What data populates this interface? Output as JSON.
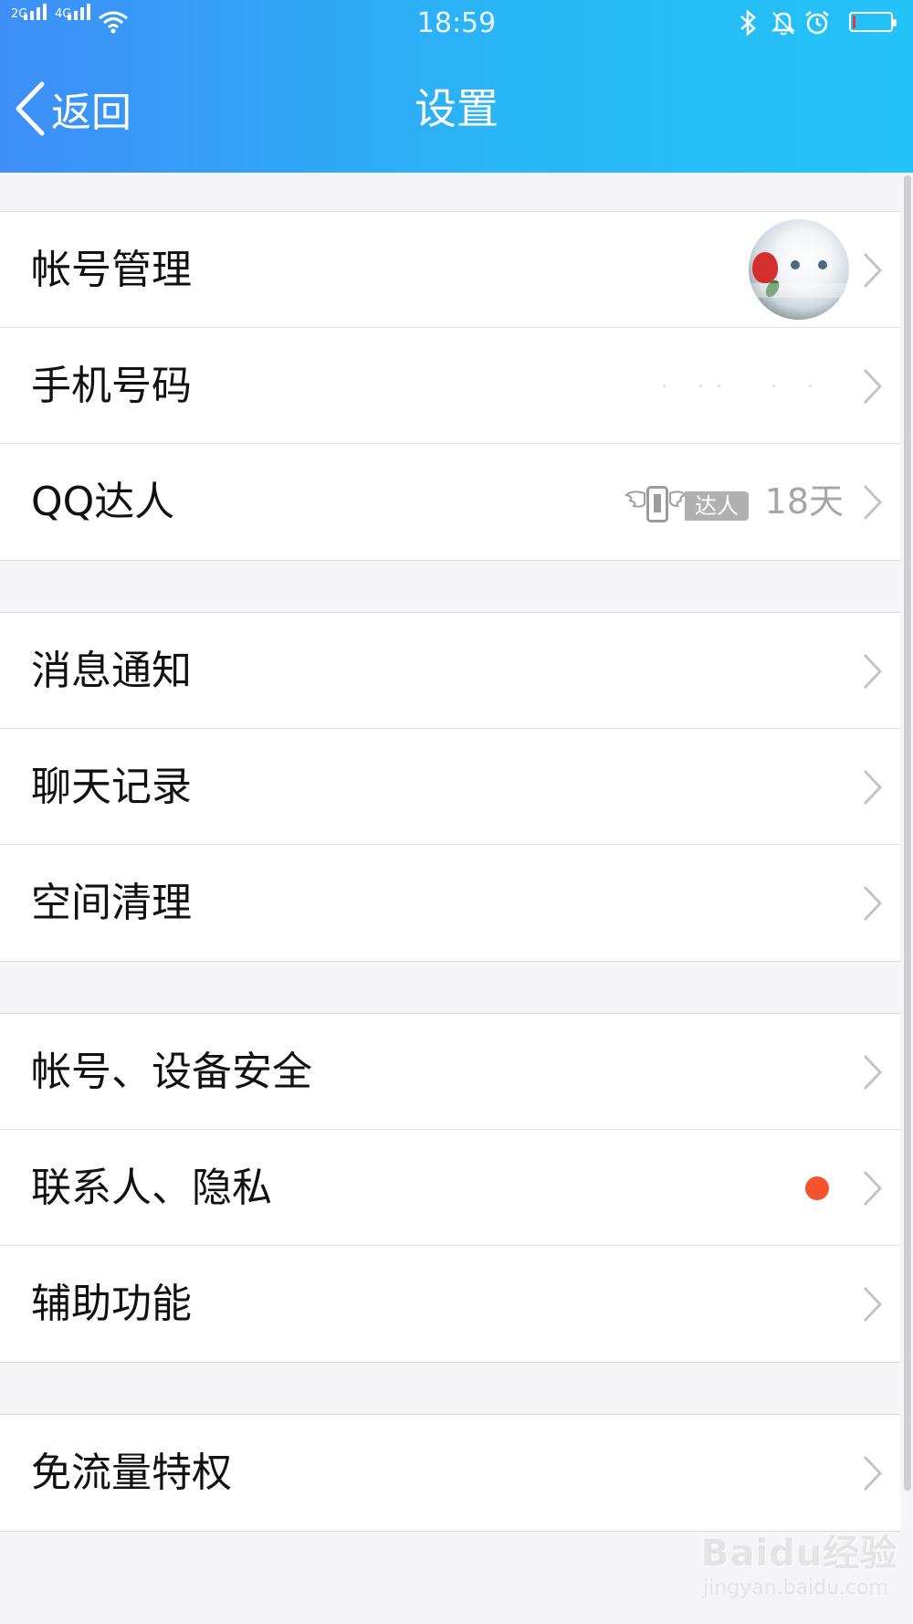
{
  "status_bar": {
    "sim1": "2G",
    "sim2": "4G",
    "time": "18:59",
    "battery_level": 0.08
  },
  "nav": {
    "back_label": "返回",
    "title": "设置"
  },
  "groups": [
    {
      "rows": [
        {
          "label": "帐号管理"
        },
        {
          "label": "手机号码"
        },
        {
          "label": "QQ达人",
          "badge_text": "达人",
          "days": "18天"
        }
      ]
    },
    {
      "rows": [
        {
          "label": "消息通知"
        },
        {
          "label": "聊天记录"
        },
        {
          "label": "空间清理"
        }
      ]
    },
    {
      "rows": [
        {
          "label": "帐号、设备安全"
        },
        {
          "label": "联系人、隐私"
        },
        {
          "label": "辅助功能"
        }
      ]
    },
    {
      "rows": [
        {
          "label": "免流量特权"
        }
      ]
    }
  ],
  "watermark": {
    "logo": "Baidu经验",
    "url": "jingyan.baidu.com"
  },
  "colors": {
    "header_start": "#3e8ef7",
    "header_end": "#23c3f8",
    "notification_dot": "#f4532e"
  }
}
